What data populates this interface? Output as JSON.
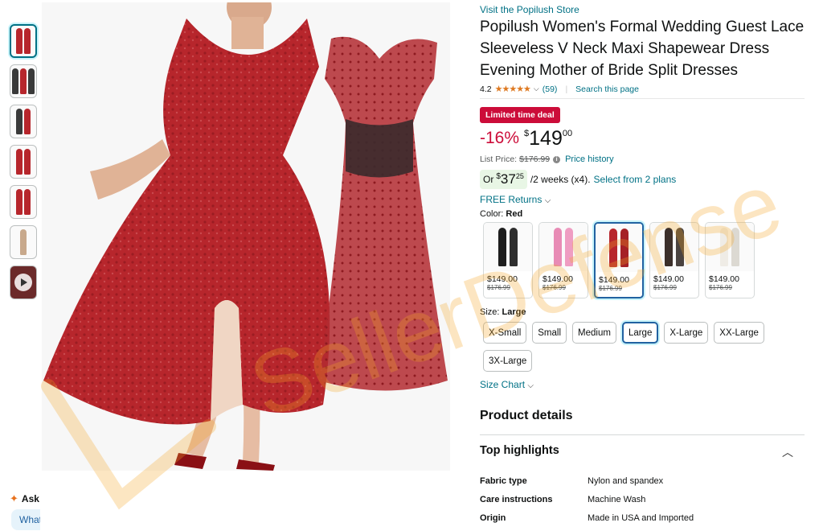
{
  "store_link": "Visit the Popilush Store",
  "title": "Popilush Women's Formal Wedding Guest Lace Sleeveless V Neck Maxi Shapewear Dress Evening Mother of Bride Split Dresses",
  "rating": {
    "value": "4.2",
    "stars": "★★★★★",
    "count": "(59)",
    "search_link": "Search this page"
  },
  "deal_badge": "Limited time deal",
  "price": {
    "discount": "-16%",
    "currency": "$",
    "whole": "149",
    "fraction": "00"
  },
  "list_price": {
    "label": "List Price:",
    "value": "$176.99",
    "history_link": "Price history"
  },
  "plan": {
    "or": "Or",
    "currency": "$",
    "whole": "37",
    "fraction": "25",
    "text": "/2 weeks (x4).",
    "link": "Select from 2 plans"
  },
  "returns": "FREE Returns",
  "color": {
    "label": "Color:",
    "selected": "Red",
    "options": [
      {
        "name": "Black",
        "price": "$149.00",
        "list": "$176.99",
        "c1": "#1e1e1e",
        "c2": "#2e2e2e"
      },
      {
        "name": "Pink",
        "price": "$149.00",
        "list": "$176.99",
        "c1": "#e88bb5",
        "c2": "#ef9dc2"
      },
      {
        "name": "Red",
        "price": "$149.00",
        "list": "$176.99",
        "c1": "#b7262c",
        "c2": "#a52026"
      },
      {
        "name": "Black Lace",
        "price": "$149.00",
        "list": "$176.99",
        "c1": "#3b2f2a",
        "c2": "#4a4340"
      },
      {
        "name": "White",
        "price": "$149.00",
        "list": "$176.99",
        "c1": "#efece6",
        "c2": "#dcd9d2"
      }
    ]
  },
  "size": {
    "label": "Size:",
    "selected": "Large",
    "options": [
      "X-Small",
      "Small",
      "Medium",
      "Large",
      "X-Large",
      "XX-Large",
      "3X-Large"
    ]
  },
  "size_chart": "Size Chart",
  "product_details_title": "Product details",
  "top_highlights": {
    "title": "Top highlights",
    "specs": [
      {
        "key": "Fabric type",
        "value": "Nylon and spandex"
      },
      {
        "key": "Care instructions",
        "value": "Machine Wash"
      },
      {
        "key": "Origin",
        "value": "Made in USA and Imported"
      }
    ]
  },
  "ask_widget": {
    "label": "Ask",
    "input_text": "What"
  },
  "watermark_text": "SellerDefense",
  "colors": {
    "link": "#007185",
    "deal": "#cc0c39",
    "star": "#de7921",
    "selected_border": "#2162a1",
    "dress": "#b7262c"
  }
}
